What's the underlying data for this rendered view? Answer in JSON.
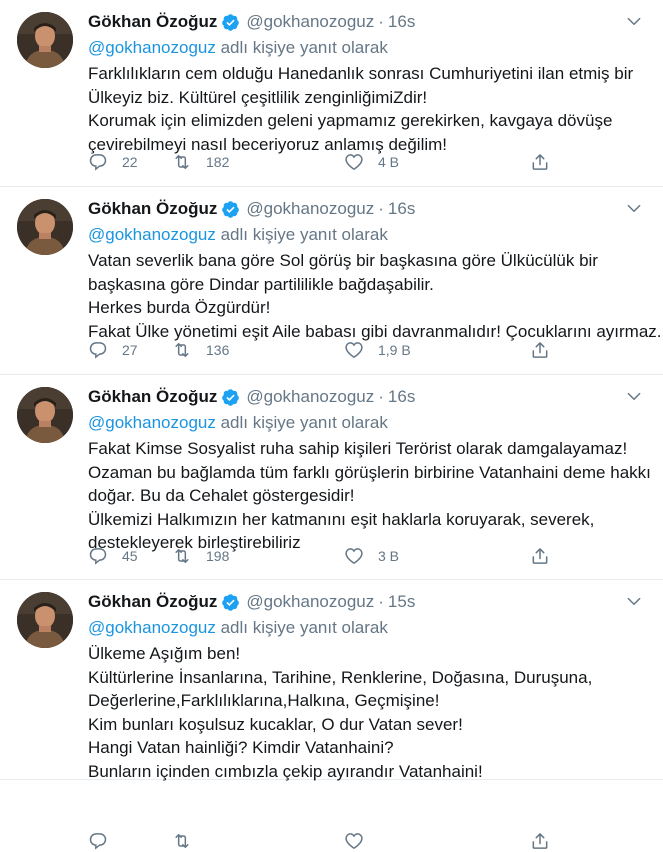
{
  "tweets": [
    {
      "author": "Gökhan Özoğuz",
      "handle": "@gokhanozoguz",
      "separator": "·",
      "time": "16s",
      "reply_mention": "@gokhanozoguz",
      "reply_suffix": "adlı kişiye yanıt olarak",
      "lines": [
        "Farklılıkların cem olduğu Hanedanlık sonrası Cumhuriyetini ilan etmiş bir",
        "Ülkeyiz biz. Kültürel çeşitlilik zenginliğimiZdir!",
        "Korumak için elimizden geleni yapmamız gerekirken, kavgaya dövüşe",
        "çevirebilmeyi nasıl beceriyoruz anlamış değilim!"
      ],
      "replies": "22",
      "retweets": "182",
      "likes": "4 B"
    },
    {
      "author": "Gökhan Özoğuz",
      "handle": "@gokhanozoguz",
      "separator": "·",
      "time": "16s",
      "reply_mention": "@gokhanozoguz",
      "reply_suffix": "adlı kişiye yanıt olarak",
      "lines": [
        "Vatan severlik bana göre Sol görüş bir başkasına göre Ülkücülük bir",
        "başkasına göre Dindar partililikle bağdaşabilir.",
        "Herkes burda Özgürdür!",
        "Fakat Ülke yönetimi eşit Aile babası gibi davranmalıdır! Çocuklarını ayırmaz."
      ],
      "replies": "27",
      "retweets": "136",
      "likes": "1,9 B"
    },
    {
      "author": "Gökhan Özoğuz",
      "handle": "@gokhanozoguz",
      "separator": "·",
      "time": "16s",
      "reply_mention": "@gokhanozoguz",
      "reply_suffix": "adlı kişiye yanıt olarak",
      "lines": [
        "Fakat Kimse Sosyalist ruha sahip kişileri Terörist olarak damgalayamaz!",
        "Ozaman bu bağlamda tüm farklı görüşlerin birbirine Vatanhaini deme hakkı",
        "doğar. Bu da Cehalet göstergesidir!",
        "Ülkemizi Halkımızın her katmanını eşit haklarla koruyarak, severek,",
        "destekleyerek birleştirebiliriz"
      ],
      "replies": "45",
      "retweets": "198",
      "likes": "3 B"
    },
    {
      "author": "Gökhan Özoğuz",
      "handle": "@gokhanozoguz",
      "separator": "·",
      "time": "15s",
      "reply_mention": "@gokhanozoguz",
      "reply_suffix": "adlı kişiye yanıt olarak",
      "lines": [
        "Ülkeme Aşığım ben!",
        "Kültürlerine İnsanlarına, Tarihine, Renklerine, Doğasına, Duruşuna,",
        "Değerlerine,Farklılıklarına,Halkına, Geçmişine!",
        "Kim bunları koşulsuz kucaklar, O dur Vatan sever!",
        "Hangi Vatan hainliği? Kimdir Vatanhaini?",
        "Bunların içinden cımbızla çekip ayırandır Vatanhaini!"
      ],
      "replies": "",
      "retweets": "",
      "likes": ""
    }
  ],
  "colors": {
    "name": "#14171a",
    "secondary": "#657786",
    "link": "#1b95e0",
    "verified": "#1da1f2",
    "border": "#e6ecf0"
  },
  "icons": [
    "verified-badge-icon",
    "caret-down-icon",
    "reply-icon",
    "retweet-icon",
    "like-icon",
    "share-icon"
  ]
}
